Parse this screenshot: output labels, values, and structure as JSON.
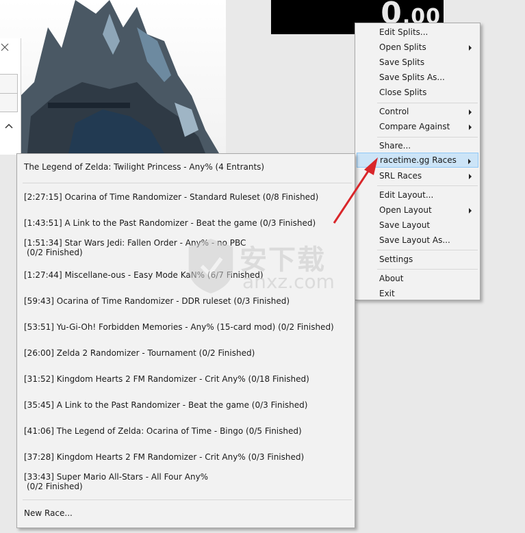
{
  "timer": {
    "main": "0",
    "sub": ".00"
  },
  "context_menu": {
    "items": [
      {
        "label": "Edit Splits...",
        "submenu": false
      },
      {
        "label": "Open Splits",
        "submenu": true
      },
      {
        "label": "Save Splits",
        "submenu": false
      },
      {
        "label": "Save Splits As...",
        "submenu": false
      },
      {
        "label": "Close Splits",
        "submenu": false
      },
      {
        "label": "Control",
        "submenu": true
      },
      {
        "label": "Compare Against",
        "submenu": true
      },
      {
        "label": "Share...",
        "submenu": false
      },
      {
        "label": "racetime.gg Races",
        "submenu": true,
        "highlighted": true
      },
      {
        "label": "SRL Races",
        "submenu": true
      },
      {
        "label": "Edit Layout...",
        "submenu": false
      },
      {
        "label": "Open Layout",
        "submenu": true
      },
      {
        "label": "Save Layout",
        "submenu": false
      },
      {
        "label": "Save Layout As...",
        "submenu": false
      },
      {
        "label": "Settings",
        "submenu": false
      },
      {
        "label": "About",
        "submenu": false
      },
      {
        "label": "Exit",
        "submenu": false
      }
    ]
  },
  "races_submenu": {
    "header": "The Legend of Zelda: Twilight Princess - Any% (4 Entrants)",
    "races": [
      {
        "line1": "[2:27:15] Ocarina of Time Randomizer - Standard Ruleset (0/8 Finished)",
        "line2": ""
      },
      {
        "line1": "[1:43:51] A Link to the Past Randomizer - Beat the game (0/3 Finished)",
        "line2": ""
      },
      {
        "line1": "[1:51:34] Star Wars Jedi: Fallen Order - Any% - no PBC",
        "line2": "(0/2 Finished)"
      },
      {
        "line1": "[1:27:44] Miscellane-ous - Easy Mode KaN% (6/7 Finished)",
        "line2": ""
      },
      {
        "line1": "[59:43] Ocarina of Time Randomizer - DDR ruleset (0/3 Finished)",
        "line2": ""
      },
      {
        "line1": "[53:51] Yu-Gi-Oh! Forbidden Memories - Any% (15-card mod) (0/2 Finished)",
        "line2": ""
      },
      {
        "line1": "[26:00] Zelda 2 Randomizer - Tournament (0/2 Finished)",
        "line2": ""
      },
      {
        "line1": "[31:52] Kingdom Hearts 2 FM Randomizer - Crit Any% (0/18 Finished)",
        "line2": ""
      },
      {
        "line1": "[35:45] A Link to the Past Randomizer - Beat the game (0/3 Finished)",
        "line2": ""
      },
      {
        "line1": "[41:06] The Legend of Zelda: Ocarina of Time - Bingo (0/5 Finished)",
        "line2": ""
      },
      {
        "line1": "[37:28] Kingdom Hearts 2 FM Randomizer - Crit Any% (0/3 Finished)",
        "line2": ""
      },
      {
        "line1": "[33:43] Super Mario All-Stars - All Four Any%",
        "line2": "(0/2 Finished)"
      }
    ],
    "new_race": "New Race..."
  },
  "watermark": {
    "chinese": "安下载",
    "domain": "anxz.com"
  },
  "colors": {
    "highlight_bg": "#cce4f7",
    "highlight_border": "#90c8f6",
    "arrow": "#d9262a",
    "timer_bg": "#000000"
  }
}
